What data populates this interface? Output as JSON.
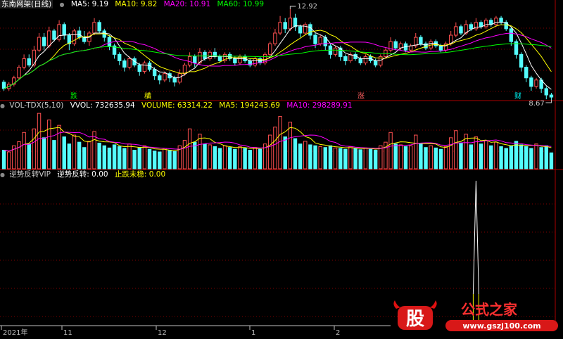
{
  "panel_main": {
    "title": "东南网架(日线)",
    "ma_labels": [
      {
        "text": "MA5: 9.19",
        "color": "#ffffff"
      },
      {
        "text": "MA10: 9.82",
        "color": "#ffff00"
      },
      {
        "text": "MA20: 10.91",
        "color": "#ff00ff"
      },
      {
        "text": "MA60: 10.99",
        "color": "#00ff00"
      }
    ],
    "high_label": "12.92",
    "low_label": "8.67",
    "markers": [
      {
        "text": "跌",
        "color": "#00ff00"
      },
      {
        "text": "横",
        "color": "#ffff00"
      },
      {
        "text": "涨",
        "color": "#ff6060"
      },
      {
        "text": "财",
        "color": "#00ffff"
      }
    ]
  },
  "panel_vol": {
    "labels": [
      {
        "text": "VOL-TDX(5,10)",
        "color": "#cccccc"
      },
      {
        "text": "VVOL: 732635.94",
        "color": "#ffffff"
      },
      {
        "text": "VOLUME: 63314.22",
        "color": "#ffff00"
      },
      {
        "text": "MA5: 194243.69",
        "color": "#ffff00"
      },
      {
        "text": "MA10: 298289.91",
        "color": "#ff00ff"
      }
    ]
  },
  "panel_ind": {
    "labels": [
      {
        "text": "逆势反转VIP",
        "color": "#cccccc"
      },
      {
        "text": "逆势反转: 0.00",
        "color": "#ffffff"
      },
      {
        "text": "止跌未稳: 0.00",
        "color": "#ffff00"
      }
    ]
  },
  "axis": {
    "labels": [
      "2021年",
      "11",
      "12",
      "1",
      "2"
    ]
  },
  "watermark": {
    "logo_text": "股",
    "brand": "公式之家",
    "url": "www.gszj100.com"
  },
  "colors": {
    "up": "#ff5050",
    "down": "#54fcfc",
    "grid": "#800000",
    "border": "#aa0000"
  },
  "chart_data": {
    "type": "candlestick",
    "title": "东南网架(日线)",
    "price_extremes": {
      "high": 12.92,
      "low": 8.67
    },
    "moving_averages": {
      "MA5": 9.19,
      "MA10": 9.82,
      "MA20": 10.91,
      "MA60": 10.99
    },
    "volume": {
      "VVOL": 732635.94,
      "VOLUME": 63314.22,
      "MA5": 194243.69,
      "MA10": 298289.91
    },
    "indicator": {
      "name": "逆势反转VIP",
      "逆势反转": 0.0,
      "止跌未稳": 0.0
    },
    "candles": [
      [
        9.5,
        9.2,
        9.6,
        9.1
      ],
      [
        9.2,
        9.4,
        9.5,
        9.1
      ],
      [
        9.4,
        9.7,
        9.8,
        9.3
      ],
      [
        9.7,
        10.2,
        10.3,
        9.6
      ],
      [
        10.2,
        10.6,
        10.8,
        10.1
      ],
      [
        10.6,
        10.3,
        10.8,
        10.2
      ],
      [
        10.3,
        11.0,
        11.2,
        10.2
      ],
      [
        11.0,
        11.6,
        11.8,
        10.9
      ],
      [
        11.6,
        11.2,
        11.8,
        11.0
      ],
      [
        11.2,
        11.9,
        12.1,
        11.1
      ],
      [
        11.9,
        11.5,
        12.0,
        11.4
      ],
      [
        11.5,
        12.2,
        12.4,
        11.4
      ],
      [
        12.2,
        11.7,
        12.3,
        11.5
      ],
      [
        11.7,
        11.3,
        11.8,
        11.0
      ],
      [
        11.3,
        11.9,
        12.0,
        11.2
      ],
      [
        11.9,
        11.6,
        12.1,
        11.5
      ],
      [
        11.6,
        11.4,
        11.9,
        11.3
      ],
      [
        11.4,
        11.8,
        11.9,
        11.2
      ],
      [
        11.8,
        12.3,
        12.5,
        11.7
      ],
      [
        12.3,
        11.9,
        12.4,
        11.8
      ],
      [
        11.9,
        11.6,
        12.0,
        11.4
      ],
      [
        11.6,
        11.2,
        11.7,
        11.0
      ],
      [
        11.2,
        10.8,
        11.3,
        10.6
      ],
      [
        10.8,
        10.5,
        10.9,
        10.3
      ],
      [
        10.5,
        10.2,
        10.6,
        10.0
      ],
      [
        10.2,
        10.6,
        10.7,
        10.1
      ],
      [
        10.6,
        10.3,
        10.7,
        10.2
      ],
      [
        10.3,
        10.0,
        10.4,
        9.8
      ],
      [
        10.0,
        10.4,
        10.5,
        9.9
      ],
      [
        10.4,
        10.1,
        10.5,
        10.0
      ],
      [
        10.1,
        9.8,
        10.2,
        9.6
      ],
      [
        9.8,
        9.6,
        9.9,
        9.4
      ],
      [
        9.6,
        9.9,
        10.0,
        9.5
      ],
      [
        9.9,
        9.7,
        10.0,
        9.5
      ],
      [
        9.7,
        9.5,
        9.8,
        9.3
      ],
      [
        9.5,
        9.9,
        10.1,
        9.4
      ],
      [
        9.9,
        10.3,
        10.4,
        9.8
      ],
      [
        10.3,
        10.7,
        10.9,
        10.2
      ],
      [
        10.7,
        10.4,
        10.8,
        10.2
      ],
      [
        10.4,
        10.9,
        11.1,
        10.3
      ],
      [
        10.9,
        10.6,
        11.0,
        10.5
      ],
      [
        10.6,
        10.9,
        11.0,
        10.5
      ],
      [
        10.9,
        10.7,
        11.1,
        10.6
      ],
      [
        10.7,
        10.5,
        10.8,
        10.4
      ],
      [
        10.5,
        10.8,
        10.9,
        10.4
      ],
      [
        10.8,
        10.6,
        10.9,
        10.5
      ],
      [
        10.6,
        10.4,
        10.7,
        10.3
      ],
      [
        10.4,
        10.7,
        10.8,
        10.3
      ],
      [
        10.7,
        10.5,
        10.8,
        10.4
      ],
      [
        10.5,
        10.3,
        10.6,
        10.2
      ],
      [
        10.3,
        10.6,
        10.7,
        10.2
      ],
      [
        10.6,
        10.4,
        10.7,
        10.3
      ],
      [
        10.4,
        10.8,
        10.9,
        10.3
      ],
      [
        10.8,
        11.3,
        11.4,
        10.7
      ],
      [
        11.3,
        11.8,
        12.0,
        11.2
      ],
      [
        11.8,
        12.3,
        12.6,
        11.7
      ],
      [
        12.3,
        12.0,
        12.5,
        11.8
      ],
      [
        12.0,
        12.5,
        12.92,
        11.9
      ],
      [
        12.5,
        12.1,
        12.7,
        11.9
      ],
      [
        12.1,
        11.8,
        12.2,
        11.6
      ],
      [
        11.8,
        12.2,
        12.3,
        11.7
      ],
      [
        12.2,
        11.7,
        12.3,
        11.5
      ],
      [
        11.7,
        11.3,
        11.8,
        11.1
      ],
      [
        11.3,
        11.6,
        11.7,
        11.2
      ],
      [
        11.6,
        11.2,
        11.7,
        11.0
      ],
      [
        11.2,
        10.8,
        11.3,
        10.6
      ],
      [
        10.8,
        11.1,
        11.2,
        10.7
      ],
      [
        11.1,
        10.7,
        11.2,
        10.5
      ],
      [
        10.7,
        10.5,
        10.8,
        10.3
      ],
      [
        10.5,
        10.8,
        10.9,
        10.4
      ],
      [
        10.8,
        10.6,
        10.9,
        10.5
      ],
      [
        10.6,
        10.4,
        10.7,
        10.3
      ],
      [
        10.4,
        10.7,
        10.8,
        10.3
      ],
      [
        10.7,
        10.5,
        10.8,
        10.4
      ],
      [
        10.5,
        10.3,
        10.6,
        10.2
      ],
      [
        10.3,
        10.7,
        10.8,
        10.2
      ],
      [
        10.7,
        11.0,
        11.1,
        10.6
      ],
      [
        11.0,
        11.4,
        11.6,
        10.9
      ],
      [
        11.4,
        11.1,
        11.5,
        11.0
      ],
      [
        11.1,
        11.3,
        11.4,
        11.0
      ],
      [
        11.3,
        11.0,
        11.4,
        10.9
      ],
      [
        11.0,
        11.2,
        11.3,
        10.9
      ],
      [
        11.2,
        11.6,
        11.8,
        11.1
      ],
      [
        11.6,
        11.3,
        11.7,
        11.2
      ],
      [
        11.3,
        11.1,
        11.4,
        11.0
      ],
      [
        11.1,
        11.4,
        11.5,
        11.0
      ],
      [
        11.4,
        11.2,
        11.5,
        11.1
      ],
      [
        11.2,
        11.0,
        11.3,
        10.9
      ],
      [
        11.0,
        11.3,
        11.4,
        10.9
      ],
      [
        11.3,
        11.7,
        11.9,
        11.2
      ],
      [
        11.7,
        12.1,
        12.3,
        11.6
      ],
      [
        12.1,
        11.8,
        12.2,
        11.7
      ],
      [
        11.8,
        12.2,
        12.4,
        11.7
      ],
      [
        12.2,
        12.0,
        12.3,
        11.9
      ],
      [
        12.0,
        12.3,
        12.5,
        11.9
      ],
      [
        12.3,
        12.1,
        12.4,
        12.0
      ],
      [
        12.1,
        12.4,
        12.5,
        12.0
      ],
      [
        12.4,
        12.2,
        12.5,
        12.1
      ],
      [
        12.2,
        12.5,
        12.6,
        12.1
      ],
      [
        12.5,
        12.3,
        12.6,
        12.2
      ],
      [
        12.3,
        12.0,
        12.4,
        11.9
      ],
      [
        12.0,
        11.4,
        12.1,
        11.2
      ],
      [
        11.4,
        10.8,
        11.5,
        10.6
      ],
      [
        10.8,
        10.2,
        10.9,
        10.0
      ],
      [
        10.2,
        9.7,
        10.3,
        9.5
      ],
      [
        9.7,
        9.3,
        9.8,
        9.1
      ],
      [
        9.3,
        9.6,
        9.7,
        9.2
      ],
      [
        9.6,
        9.2,
        9.7,
        9.0
      ],
      [
        9.2,
        8.9,
        9.3,
        8.7
      ],
      [
        8.9,
        8.8,
        9.0,
        8.67
      ]
    ],
    "volumes": [
      420,
      380,
      520,
      610,
      820,
      560,
      900,
      1250,
      700,
      1100,
      640,
      980,
      720,
      560,
      760,
      600,
      480,
      620,
      840,
      580,
      520,
      470,
      540,
      500,
      460,
      560,
      420,
      470,
      520,
      440,
      400,
      380,
      460,
      420,
      390,
      520,
      640,
      900,
      600,
      780,
      560,
      540,
      500,
      460,
      520,
      480,
      440,
      500,
      460,
      420,
      480,
      440,
      560,
      760,
      940,
      1180,
      720,
      1050,
      680,
      560,
      620,
      540,
      520,
      500,
      480,
      520,
      470,
      460,
      440,
      500,
      460,
      430,
      470,
      440,
      420,
      520,
      600,
      820,
      560,
      540,
      500,
      520,
      760,
      560,
      480,
      520,
      470,
      440,
      500,
      700,
      860,
      580,
      780,
      540,
      720,
      560,
      640,
      520,
      600,
      500,
      460,
      520,
      620,
      540,
      500,
      460,
      560,
      480,
      520,
      360
    ],
    "volume_ylim": [
      0,
      1300
    ],
    "signal_spike": {
      "index": 94,
      "value": 1.0
    }
  }
}
